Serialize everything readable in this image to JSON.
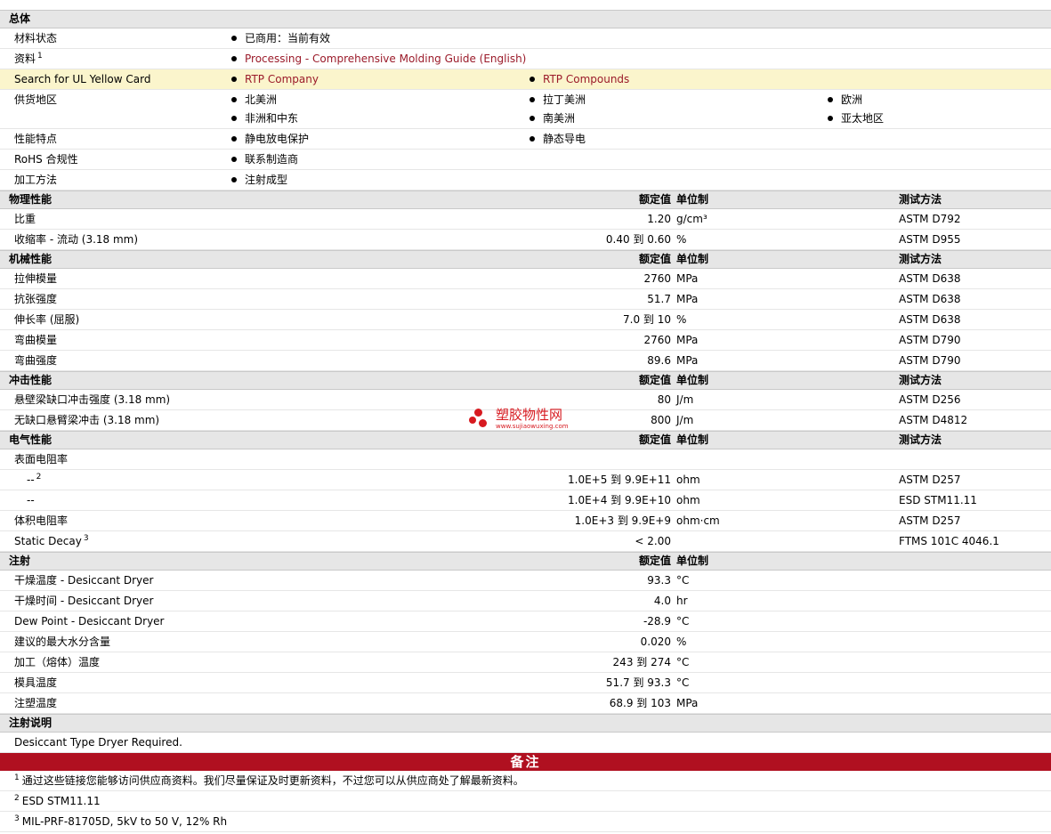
{
  "general": {
    "title": "总体",
    "material_status_label": "材料状态",
    "material_status_value": "已商用：当前有效",
    "literature_label": "资料",
    "literature_sup": "1",
    "literature_link": "Processing - Comprehensive Molding Guide (English)",
    "ul_label": "Search for UL Yellow Card",
    "ul_link1": "RTP Company",
    "ul_link2": "RTP Compounds",
    "availability_label": "供货地区",
    "regions": [
      "北美洲",
      "拉丁美洲",
      "欧洲",
      "非洲和中东",
      "南美洲",
      "亚太地区"
    ],
    "features_label": "性能特点",
    "features": [
      "静电放电保护",
      "静态导电"
    ],
    "rohs_label": "RoHS 合规性",
    "rohs_value": "联系制造商",
    "processing_label": "加工方法",
    "processing_value": "注射成型"
  },
  "headers": {
    "nominal": "额定值",
    "unit": "单位制",
    "test": "测试方法"
  },
  "physical": {
    "title": "物理性能",
    "rows": [
      {
        "label": "比重",
        "value": "1.20",
        "unit": "g/cm³",
        "test": "ASTM D792"
      },
      {
        "label": "收缩率  - 流动  (3.18 mm)",
        "value": "0.40 到  0.60",
        "unit": "%",
        "test": "ASTM D955"
      }
    ]
  },
  "mechanical": {
    "title": "机械性能",
    "rows": [
      {
        "label": "拉伸模量",
        "value": "2760",
        "unit": "MPa",
        "test": "ASTM D638"
      },
      {
        "label": "抗张强度",
        "value": "51.7",
        "unit": "MPa",
        "test": "ASTM D638"
      },
      {
        "label": "伸长率  (屈服)",
        "value": "7.0 到  10",
        "unit": "%",
        "test": "ASTM D638"
      },
      {
        "label": "弯曲模量",
        "value": "2760",
        "unit": "MPa",
        "test": "ASTM D790"
      },
      {
        "label": "弯曲强度",
        "value": "89.6",
        "unit": "MPa",
        "test": "ASTM D790"
      }
    ]
  },
  "impact": {
    "title": "冲击性能",
    "rows": [
      {
        "label": "悬壁梁缺口冲击强度  (3.18 mm)",
        "value": "80",
        "unit": "J/m",
        "test": "ASTM D256"
      },
      {
        "label": "无缺口悬臂梁冲击  (3.18 mm)",
        "value": "800",
        "unit": "J/m",
        "test": "ASTM D4812"
      }
    ]
  },
  "electrical": {
    "title": "电气性能",
    "surface_label": "表面电阻率",
    "sub1": {
      "label": "--",
      "sup": "2",
      "value": "1.0E+5 到  9.9E+11",
      "unit": "ohm",
      "test": "ASTM D257"
    },
    "sub2": {
      "label": "--",
      "value": "1.0E+4 到  9.9E+10",
      "unit": "ohm",
      "test": "ESD STM11.11"
    },
    "volume": {
      "label": "体积电阻率",
      "value": "1.0E+3 到  9.9E+9",
      "unit": "ohm·cm",
      "test": "ASTM D257"
    },
    "decay": {
      "label": "Static Decay",
      "sup": "3",
      "value": "< 2.00",
      "unit": "",
      "test": "FTMS 101C 4046.1"
    }
  },
  "injection": {
    "title": "注射",
    "rows": [
      {
        "label": "干燥温度  - Desiccant Dryer",
        "value": "93.3",
        "unit": "°C"
      },
      {
        "label": "干燥时间  - Desiccant Dryer",
        "value": "4.0",
        "unit": "hr"
      },
      {
        "label": "Dew Point - Desiccant Dryer",
        "value": "-28.9",
        "unit": "°C"
      },
      {
        "label": "建议的最大水分含量",
        "value": "0.020",
        "unit": "%"
      },
      {
        "label": "加工（熔体）温度",
        "value": "243 到  274",
        "unit": "°C"
      },
      {
        "label": "模具温度",
        "value": "51.7 到  93.3",
        "unit": "°C"
      },
      {
        "label": "注塑温度",
        "value": "68.9 到  103",
        "unit": "MPa"
      }
    ]
  },
  "injection_notes": {
    "title": "注射说明",
    "text": "Desiccant Type Dryer Required."
  },
  "remarks": {
    "title": "备注",
    "notes": [
      {
        "sup": "1",
        "text": "通过这些链接您能够访问供应商资料。我们尽量保证及时更新资料，不过您可以从供应商处了解最新资料。"
      },
      {
        "sup": "2",
        "text": "ESD STM11.11"
      },
      {
        "sup": "3",
        "text": "MIL-PRF-81705D, 5kV to 50 V, 12% Rh"
      }
    ]
  },
  "watermark": {
    "title": "塑胶物性网",
    "url": "www.sujiaowuxing.com"
  },
  "colors": {
    "header_bg": "#e6e6e6",
    "highlight_bg": "#fbf5cc",
    "link": "#9b1b2a",
    "banner_bg": "#b01020"
  }
}
